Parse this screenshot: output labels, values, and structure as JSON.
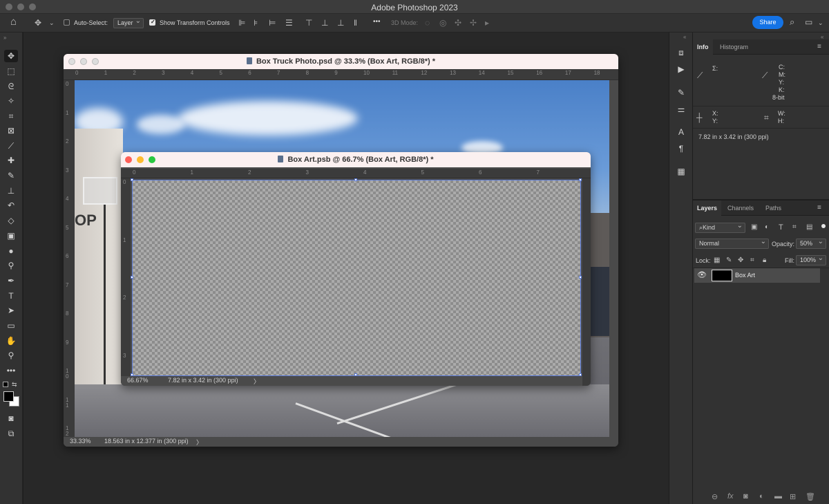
{
  "app": {
    "title": "Adobe Photoshop 2023"
  },
  "options_bar": {
    "auto_select_label": "Auto-Select:",
    "auto_select_value": "Layer",
    "show_transform_label": "Show Transform Controls",
    "three_d_mode_label": "3D Mode:",
    "more_icon": "•••",
    "share_label": "Share"
  },
  "colors": {
    "accent": "#1473e6",
    "doc_title_bg": "#fbf0f0",
    "selection": "#5b7bd8"
  },
  "doc_back": {
    "title": "Box Truck Photo.psd @ 33.3% (Box Art, RGB/8*) *",
    "ruler_h": [
      "0",
      "1",
      "2",
      "3",
      "4",
      "5",
      "6",
      "7",
      "8",
      "9",
      "10",
      "11",
      "12",
      "13",
      "14",
      "15",
      "16",
      "17",
      "18"
    ],
    "ruler_v": [
      "0",
      "1",
      "2",
      "3",
      "4",
      "5",
      "6",
      "7",
      "8",
      "9",
      "1\n0",
      "1\n1",
      "1\n2"
    ],
    "zoom": "33.33%",
    "dims": "18.563 in x 12.377 in (300 ppi)",
    "arrow": "〉",
    "photo_sign": "OP"
  },
  "doc_front": {
    "title": "Box Art.psb @ 66.7% (Box Art, RGB/8*) *",
    "ruler_h": [
      "0",
      "1",
      "2",
      "3",
      "4",
      "5",
      "6",
      "7"
    ],
    "ruler_v": [
      "0",
      "1",
      "2",
      "3"
    ],
    "zoom": "66.67%",
    "dims": "7.82 in x 3.42 in (300 ppi)",
    "arrow": "〉"
  },
  "info_panel": {
    "tabs": [
      "Info",
      "Histogram"
    ],
    "sigma": "Σ:",
    "cmyk": [
      "C:",
      "M:",
      "Y:",
      "K:"
    ],
    "bitdepth": "8-bit",
    "xy": [
      "X:",
      "Y:"
    ],
    "wh": [
      "W:",
      "H:"
    ],
    "doc_size": "7.82 in x 3.42 in (300 ppi)"
  },
  "layers_panel": {
    "tabs": [
      "Layers",
      "Channels",
      "Paths"
    ],
    "kind_label": "Kind",
    "blend_mode": "Normal",
    "opacity_label": "Opacity:",
    "opacity_value": "50%",
    "lock_label": "Lock:",
    "fill_label": "Fill:",
    "fill_value": "100%",
    "layers": [
      {
        "name": "Box Art"
      }
    ],
    "bottom_icons": [
      "link-icon",
      "fx-icon",
      "mask-icon",
      "adjustment-icon",
      "folder-icon",
      "new-layer-icon",
      "trash-icon"
    ]
  }
}
